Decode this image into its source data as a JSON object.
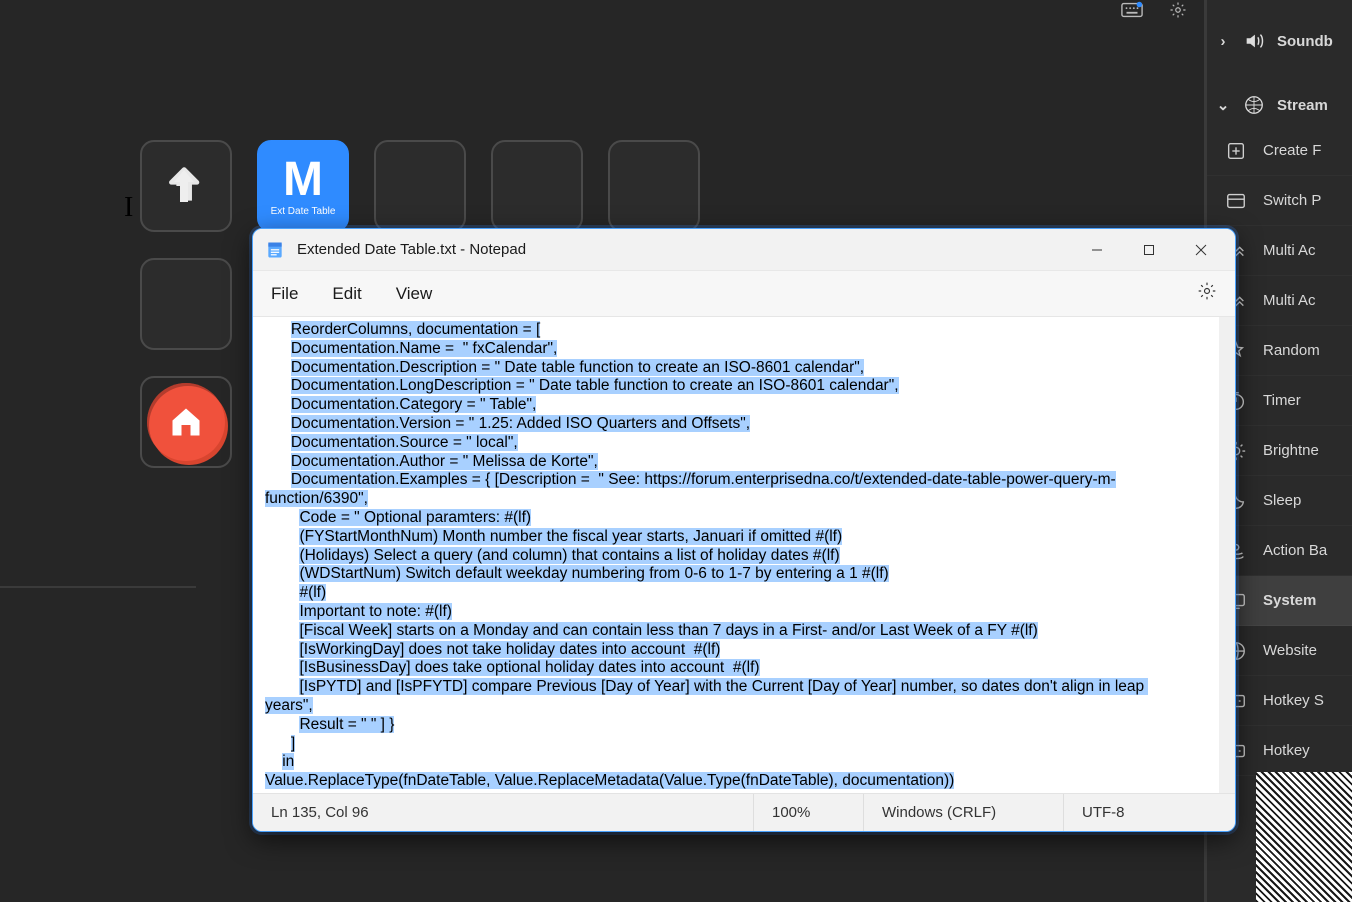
{
  "dock": {
    "tile_m_letter": "M",
    "tile_m_caption": "Ext Date Table"
  },
  "right_panel": {
    "section1_label": "Soundb",
    "section2_label": "Stream",
    "items": [
      "Create F",
      "Switch P",
      "Multi Ac",
      "Multi Ac",
      "Random",
      "Timer",
      "Brightne",
      "Sleep",
      "Action Ba",
      "System",
      "Website",
      "Hotkey S",
      "Hotkey"
    ],
    "active_index": 9
  },
  "notepad": {
    "title": "Extended Date Table.txt - Notepad",
    "menus": {
      "file": "File",
      "edit": "Edit",
      "view": "View"
    },
    "status": {
      "lncol": "Ln 135, Col 96",
      "zoom": "100%",
      "eol": "Windows (CRLF)",
      "enc": "UTF-8"
    },
    "lines": [
      {
        "indent": "      ",
        "text": "ReorderColumns, documentation = [",
        "hl": true,
        "tail": ""
      },
      {
        "indent": "      ",
        "text": "Documentation.Name =  \" fxCalendar\",",
        "hl": true,
        "tail": ""
      },
      {
        "indent": "      ",
        "text": "Documentation.Description = \" Date table function to create an ISO-8601 calendar\",",
        "hl": true,
        "tail": ""
      },
      {
        "indent": "      ",
        "text": "Documentation.LongDescription = \" Date table function to create an ISO-8601 calendar\",",
        "hl": true,
        "tail": ""
      },
      {
        "indent": "      ",
        "text": "Documentation.Category = \" Table\",",
        "hl": true,
        "tail": ""
      },
      {
        "indent": "      ",
        "text": "Documentation.Version = \" 1.25: Added ISO Quarters and Offsets\",",
        "hl": true,
        "tail": ""
      },
      {
        "indent": "      ",
        "text": "Documentation.Source = \" local\",",
        "hl": true,
        "tail": ""
      },
      {
        "indent": "      ",
        "text": "Documentation.Author = \" Melissa de Korte\",",
        "hl": true,
        "tail": ""
      },
      {
        "indent": "      ",
        "text": "Documentation.Examples = { [Description =  \" See: https://forum.enterprisedna.co/t/extended-date-table-power-query-m-",
        "hl": true,
        "tail": "",
        "wrap": true
      },
      {
        "indent": "",
        "text": "function/6390\",",
        "hl": true,
        "tail": ""
      },
      {
        "indent": "        ",
        "text": "Code = \" Optional paramters: #(lf)",
        "hl": true,
        "tail": ""
      },
      {
        "indent": "        ",
        "text": "(FYStartMonthNum) Month number the fiscal year starts, Januari if omitted #(lf)",
        "hl": true,
        "tail": ""
      },
      {
        "indent": "        ",
        "text": "(Holidays) Select a query (and column) that contains a list of holiday dates #(lf)",
        "hl": true,
        "tail": ""
      },
      {
        "indent": "        ",
        "text": "(WDStartNum) Switch default weekday numbering from 0-6 to 1-7 by entering a 1 #(lf)",
        "hl": true,
        "tail": ""
      },
      {
        "indent": "        ",
        "text": "#(lf)",
        "hl": true,
        "tail": ""
      },
      {
        "indent": "        ",
        "text": "Important to note: #(lf)",
        "hl": true,
        "tail": ""
      },
      {
        "indent": "        ",
        "text": "[Fiscal Week] starts on a Monday and can contain less than 7 days in a First- and/or Last Week of a FY #(lf)",
        "hl": true,
        "tail": ""
      },
      {
        "indent": "        ",
        "text": "[IsWorkingDay] does not take holiday dates into account  #(lf)",
        "hl": true,
        "tail": ""
      },
      {
        "indent": "        ",
        "text": "[IsBusinessDay] does take optional holiday dates into account  #(lf)",
        "hl": true,
        "tail": ""
      },
      {
        "indent": "        ",
        "text": "[IsPYTD] and [IsPFYTD] compare Previous [Day of Year] with the Current [Day of Year] number, so dates don't align in leap ",
        "hl": true,
        "tail": "",
        "wrap": true
      },
      {
        "indent": "",
        "text": "years\",",
        "hl": true,
        "tail": ""
      },
      {
        "indent": "        ",
        "text": "Result = \" \" ] }",
        "hl": true,
        "tail": ""
      },
      {
        "indent": "      ",
        "text": "]",
        "hl": true,
        "tail": ""
      },
      {
        "indent": "    ",
        "text": "in",
        "hl": true,
        "tail": ""
      },
      {
        "indent": "",
        "text": "Value.ReplaceType(fnDateTable, Value.ReplaceMetadata(Value.Type(fnDateTable), documentation))",
        "hl": true,
        "tail": ""
      }
    ]
  }
}
